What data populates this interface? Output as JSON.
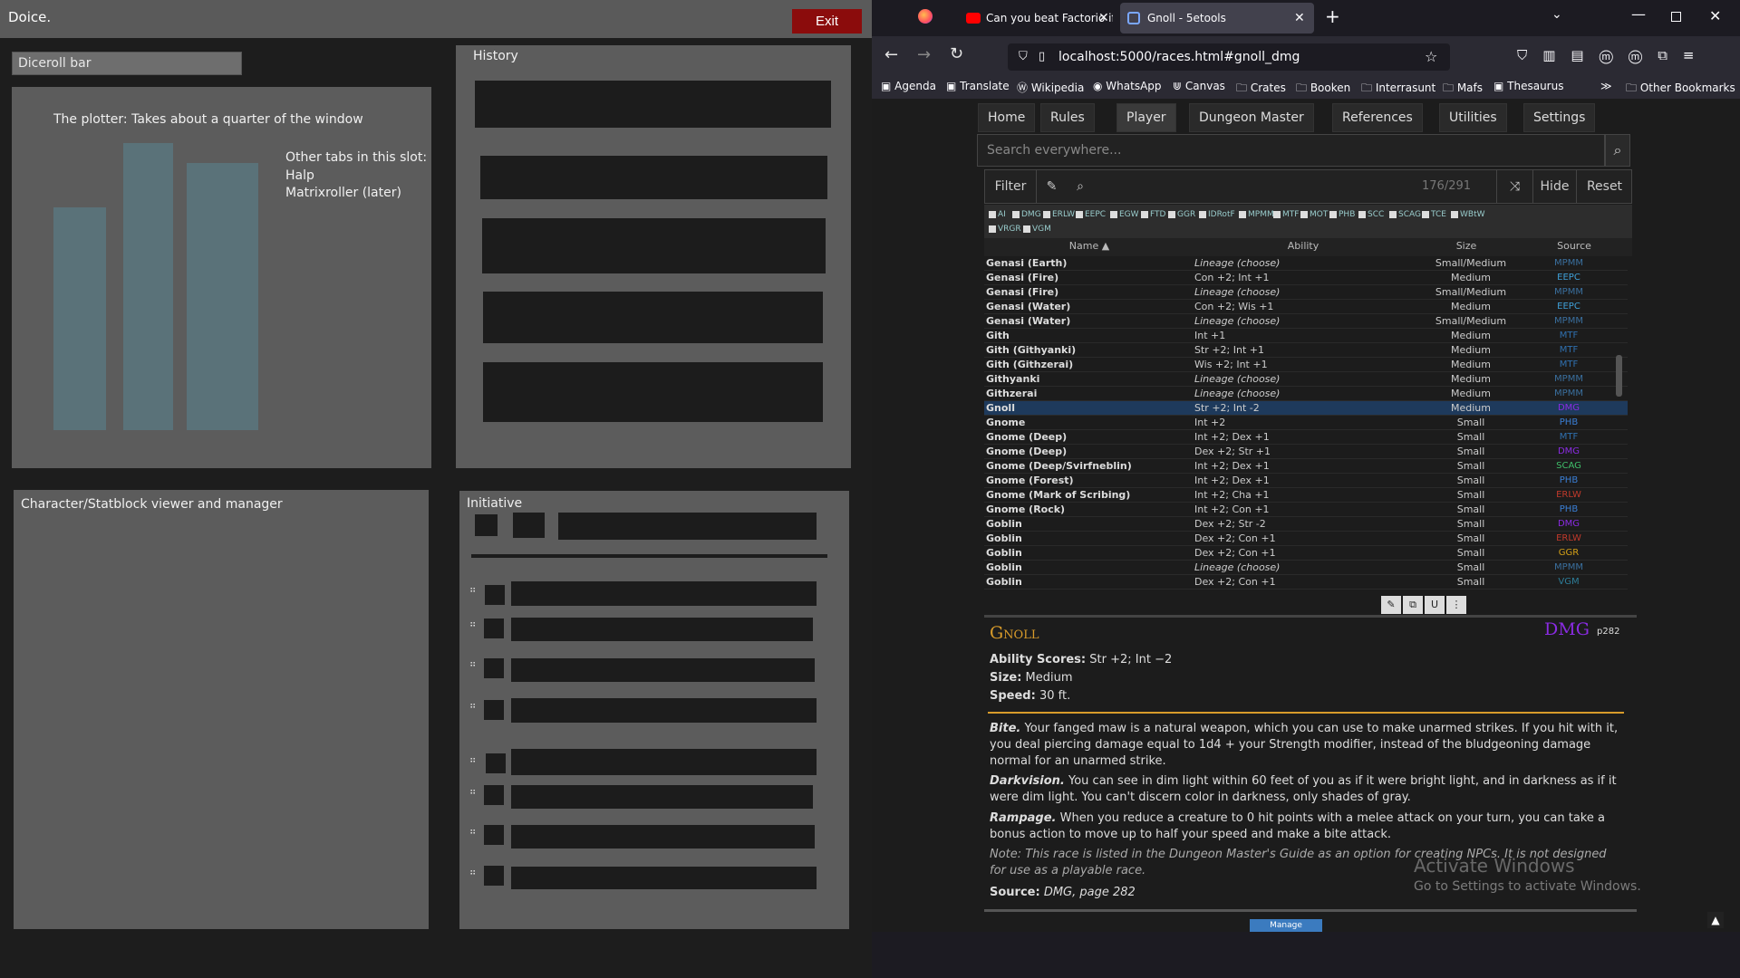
{
  "doice": {
    "title": "Doice.",
    "exit_label": "Exit",
    "diceroll_bar": "Diceroll bar",
    "plotter": {
      "title": "The plotter: Takes about a quarter of the window",
      "other_tabs": "Other tabs in this slot:",
      "tab1": "Halp",
      "tab2": "Matrixroller (later)",
      "bar_color": "#5a7279"
    },
    "history_label": "History",
    "charview_label": "Character/Statblock viewer and manager",
    "initiative_label": "Initiative"
  },
  "browser": {
    "tabs": [
      {
        "label": "Can you beat Factorio if everyth"
      },
      {
        "label": "Gnoll - 5etools"
      }
    ],
    "url": "localhost:5000/races.html#gnoll_dmg",
    "bookmarks": [
      "Agenda",
      "Translate",
      "Wikipedia",
      "WhatsApp",
      "Canvas",
      "Crates",
      "Booken",
      "Interrasunt",
      "Mafs",
      "Thesaurus",
      "Other Bookmarks"
    ]
  },
  "etools": {
    "nav": [
      "Home",
      "Rules",
      "Player",
      "Dungeon Master",
      "References",
      "Utilities",
      "Settings"
    ],
    "search_placeholder": "Search everywhere...",
    "filter_label": "Filter",
    "count": "176/291",
    "hide_label": "Hide",
    "reset_label": "Reset",
    "chips": [
      "AI",
      "DMG",
      "ERLW",
      "EEPC",
      "EGW",
      "FTD",
      "GGR",
      "IDRotF",
      "MPMM",
      "MTF",
      "MOT",
      "PHB",
      "SCC",
      "SCAG",
      "TCE",
      "WBtW",
      "VRGR",
      "VGM"
    ],
    "columns": [
      "Name ▲",
      "Ability",
      "Size",
      "Source"
    ],
    "rows": [
      {
        "name": "Genasi (Earth)",
        "ability": "Lineage (choose)",
        "size": "Small/Medium",
        "source": "MPMM",
        "italic": true
      },
      {
        "name": "Genasi (Fire)",
        "ability": "Con +2; Int +1",
        "size": "Medium",
        "source": "EEPC"
      },
      {
        "name": "Genasi (Fire)",
        "ability": "Lineage (choose)",
        "size": "Small/Medium",
        "source": "MPMM",
        "italic": true
      },
      {
        "name": "Genasi (Water)",
        "ability": "Con +2; Wis +1",
        "size": "Medium",
        "source": "EEPC"
      },
      {
        "name": "Genasi (Water)",
        "ability": "Lineage (choose)",
        "size": "Small/Medium",
        "source": "MPMM",
        "italic": true
      },
      {
        "name": "Gith",
        "ability": "Int +1",
        "size": "Medium",
        "source": "MTF"
      },
      {
        "name": "Gith (Githyanki)",
        "ability": "Str +2; Int +1",
        "size": "Medium",
        "source": "MTF"
      },
      {
        "name": "Gith (Githzerai)",
        "ability": "Wis +2; Int +1",
        "size": "Medium",
        "source": "MTF"
      },
      {
        "name": "Githyanki",
        "ability": "Lineage (choose)",
        "size": "Medium",
        "source": "MPMM",
        "italic": true
      },
      {
        "name": "Githzerai",
        "ability": "Lineage (choose)",
        "size": "Medium",
        "source": "MPMM",
        "italic": true
      },
      {
        "name": "Gnoll",
        "ability": "Str +2; Int -2",
        "size": "Medium",
        "source": "DMG",
        "selected": true
      },
      {
        "name": "Gnome",
        "ability": "Int +2",
        "size": "Small",
        "source": "PHB"
      },
      {
        "name": "Gnome (Deep)",
        "ability": "Int +2; Dex +1",
        "size": "Small",
        "source": "MTF"
      },
      {
        "name": "Gnome (Deep)",
        "ability": "Dex +2; Str +1",
        "size": "Small",
        "source": "DMG"
      },
      {
        "name": "Gnome (Deep/Svirfneblin)",
        "ability": "Int +2; Dex +1",
        "size": "Small",
        "source": "SCAG"
      },
      {
        "name": "Gnome (Forest)",
        "ability": "Int +2; Dex +1",
        "size": "Small",
        "source": "PHB"
      },
      {
        "name": "Gnome (Mark of Scribing)",
        "ability": "Int +2; Cha +1",
        "size": "Small",
        "source": "ERLW"
      },
      {
        "name": "Gnome (Rock)",
        "ability": "Int +2; Con +1",
        "size": "Small",
        "source": "PHB"
      },
      {
        "name": "Goblin",
        "ability": "Dex +2; Str -2",
        "size": "Small",
        "source": "DMG"
      },
      {
        "name": "Goblin",
        "ability": "Dex +2; Con +1",
        "size": "Small",
        "source": "ERLW"
      },
      {
        "name": "Goblin",
        "ability": "Dex +2; Con +1",
        "size": "Small",
        "source": "GGR"
      },
      {
        "name": "Goblin",
        "ability": "Lineage (choose)",
        "size": "Small",
        "source": "MPMM",
        "italic": true
      },
      {
        "name": "Goblin",
        "ability": "Dex +2; Con +1",
        "size": "Small",
        "source": "VGM"
      }
    ],
    "source_colors": {
      "MPMM": "#3a6f9e",
      "EEPC": "#3fa0d8",
      "MTF": "#2f6fae",
      "DMG": "#8a2be2",
      "PHB": "#3a7fd6",
      "SCAG": "#3fbf6a",
      "ERLW": "#c0392b",
      "GGR": "#d4a017",
      "VGM": "#2d7d99"
    },
    "statblock": {
      "name": "Gnoll",
      "source_abbr": "DMG",
      "page_ref": "p282",
      "ability_label": "Ability Scores:",
      "ability_value": "Str +2; Int −2",
      "size_label": "Size:",
      "size_value": "Medium",
      "speed_label": "Speed:",
      "speed_value": "30 ft.",
      "bite_title": "Bite.",
      "bite_text": "Your fanged maw is a natural weapon, which you can use to make unarmed strikes. If you hit with it, you deal piercing damage equal to 1d4 + your Strength modifier, instead of the bludgeoning damage normal for an unarmed strike.",
      "dark_title": "Darkvision.",
      "dark_text": "You can see in dim light within 60 feet of you as if it were bright light, and in darkness as if it were dim light. You can't discern color in darkness, only shades of gray.",
      "ramp_title": "Rampage.",
      "ramp_text": "When you reduce a creature to 0 hit points with a melee attack on your turn, you can take a bonus action to move up to half your speed and make a bite attack.",
      "note": "Note: This race is listed in the Dungeon Master's Guide as an option for creating NPCs. It is not designed for use as a playable race.",
      "source_line_label": "Source:",
      "source_line_value": "DMG, page 282",
      "manage_btn": "Manage Homebrew"
    },
    "watermark_title": "Activate Windows",
    "watermark_sub": "Go to Settings to activate Windows."
  }
}
